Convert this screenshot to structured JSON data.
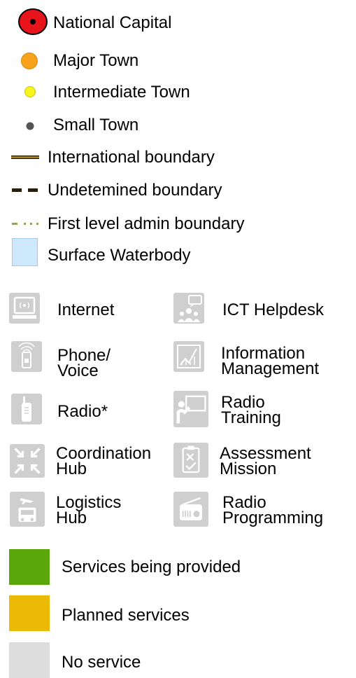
{
  "legend": {
    "symbols": [
      {
        "label": "National Capital",
        "icon": "national-capital-symbol",
        "color": "#e8141c"
      },
      {
        "label": "Major Town",
        "icon": "major-town-symbol",
        "color": "#f7a21b"
      },
      {
        "label": "Intermediate Town",
        "icon": "intermediate-town-symbol",
        "color": "#f5f51c"
      },
      {
        "label": "Small Town",
        "icon": "small-town-symbol",
        "color": "#555555"
      },
      {
        "label": "International boundary",
        "icon": "international-boundary-line",
        "color": "#8b6a1a"
      },
      {
        "label": "Undetemined boundary",
        "icon": "undetermined-boundary-line",
        "color": "#2a1e08"
      },
      {
        "label": "First level admin boundary",
        "icon": "first-level-admin-boundary-line",
        "color": "#9aa05a"
      },
      {
        "label": "Surface Waterbody",
        "icon": "surface-waterbody-swatch",
        "color": "#cde9fb"
      }
    ],
    "services": [
      {
        "label": "Internet",
        "icon": "internet-icon"
      },
      {
        "label": "ICT Helpdesk",
        "icon": "ict-helpdesk-icon"
      },
      {
        "label": "Phone/\nVoice",
        "icon": "phone-voice-icon"
      },
      {
        "label": "Information\nManagement",
        "icon": "information-management-icon"
      },
      {
        "label": "Radio*",
        "icon": "radio-icon"
      },
      {
        "label": "Radio\nTraining",
        "icon": "radio-training-icon"
      },
      {
        "label": "Coordination\nHub",
        "icon": "coordination-hub-icon"
      },
      {
        "label": "Assessment\nMission",
        "icon": "assessment-mission-icon"
      },
      {
        "label": "Logistics\nHub",
        "icon": "logistics-hub-icon"
      },
      {
        "label": "Radio\nProgramming",
        "icon": "radio-programming-icon"
      }
    ],
    "status": [
      {
        "label": "Services being provided",
        "color": "#5aa80c"
      },
      {
        "label": "Planned services",
        "color": "#ebb906"
      },
      {
        "label": "No service",
        "color": "#dcdcdc"
      }
    ]
  }
}
